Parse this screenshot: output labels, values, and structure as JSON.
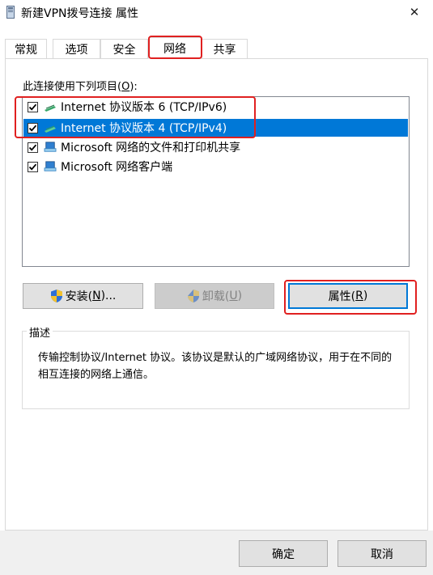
{
  "window": {
    "title": "新建VPN拨号连接 属性",
    "close_glyph": "✕"
  },
  "tabs": [
    {
      "label": "常规"
    },
    {
      "label": "选项"
    },
    {
      "label": "安全"
    },
    {
      "label": "网络",
      "active": true
    },
    {
      "label": "共享"
    }
  ],
  "network": {
    "list_label_pre": "此连接使用下列项目(",
    "list_label_key": "O",
    "list_label_post": "):",
    "items": [
      {
        "label": "Internet 协议版本 6 (TCP/IPv6)",
        "checked": true,
        "icon": "network-protocol-icon"
      },
      {
        "label": "Internet 协议版本 4 (TCP/IPv4)",
        "checked": true,
        "selected": true,
        "icon": "network-protocol-icon"
      },
      {
        "label": "Microsoft 网络的文件和打印机共享",
        "checked": true,
        "icon": "network-service-icon"
      },
      {
        "label": "Microsoft 网络客户端",
        "checked": true,
        "icon": "network-client-icon"
      }
    ],
    "install_pre": "安装(",
    "install_key": "N",
    "install_post": ")...",
    "uninstall_pre": "卸载(",
    "uninstall_key": "U",
    "uninstall_post": ")",
    "properties_pre": "属性(",
    "properties_key": "R",
    "properties_post": ")",
    "description_title": "描述",
    "description_text": "传输控制协议/Internet 协议。该协议是默认的广域网络协议，用于在不同的相互连接的网络上通信。"
  },
  "footer": {
    "ok_label": "确定",
    "cancel_label": "取消"
  },
  "colors": {
    "selection": "#0078d7",
    "highlight_annotation": "#e02020"
  }
}
